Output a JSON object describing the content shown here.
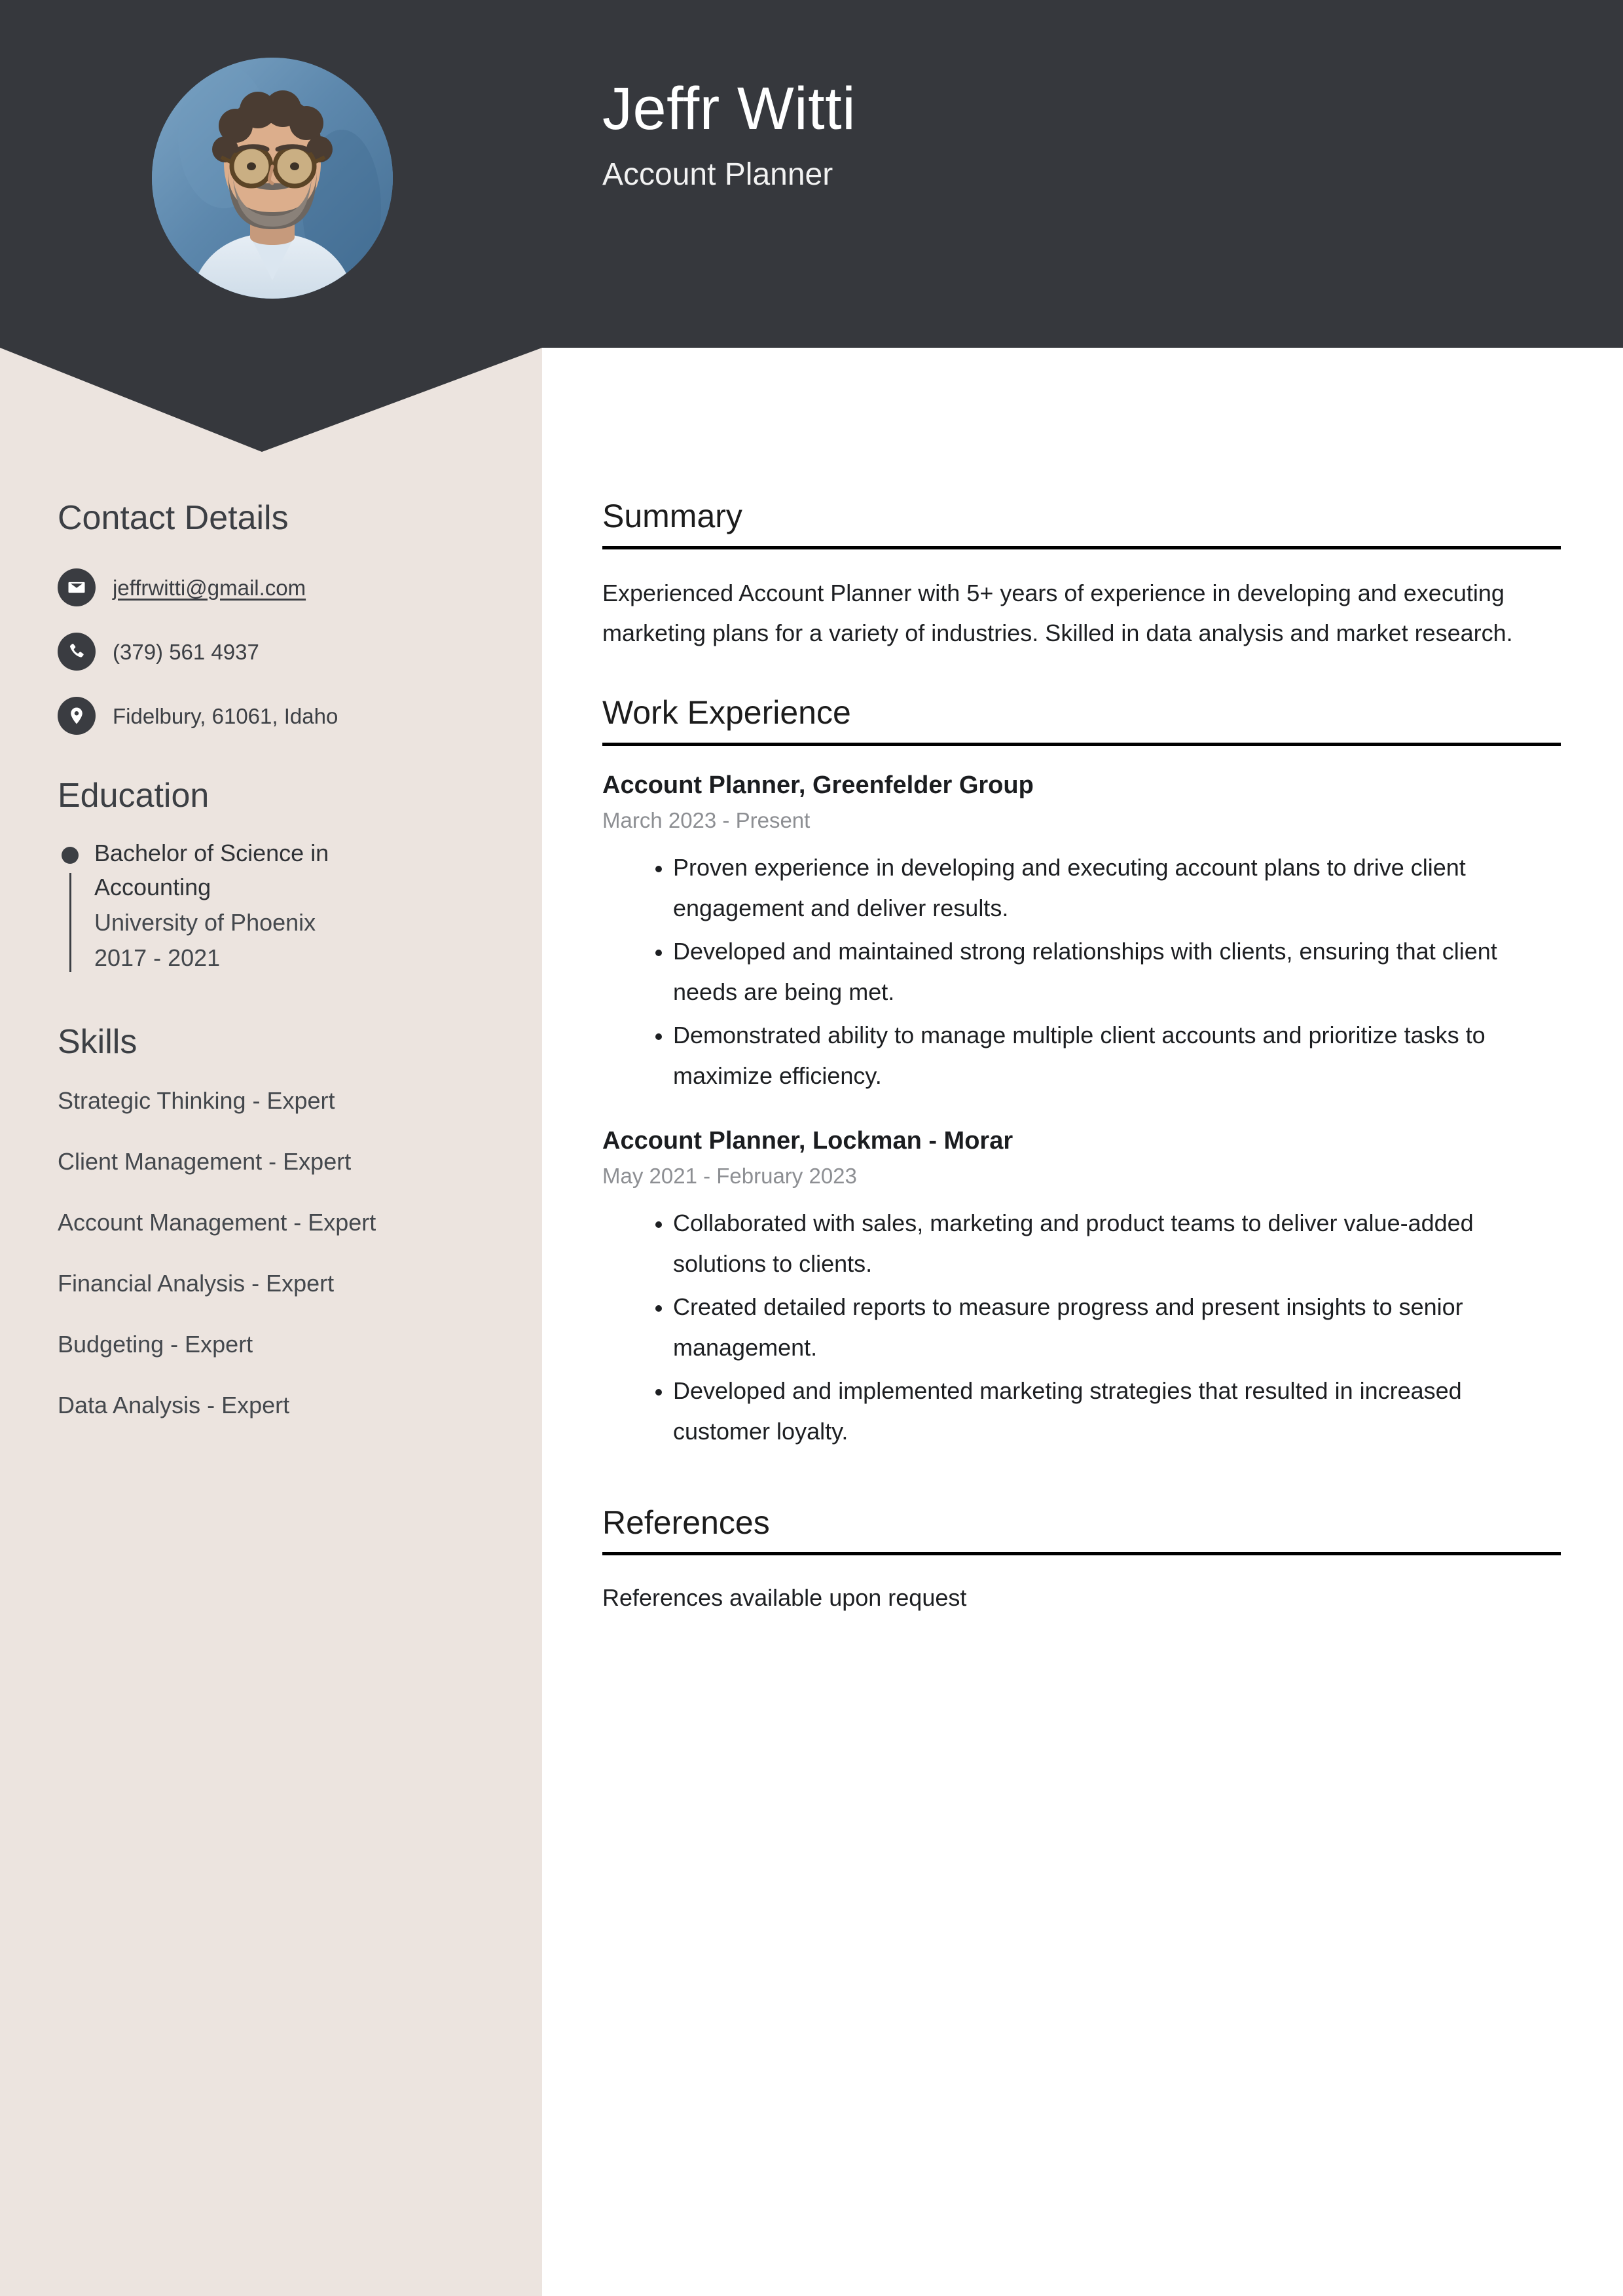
{
  "theme": {
    "header_bg": "#36383d",
    "sidebar_bg": "#ece4df",
    "main_bg": "#ffffff",
    "text_dark": "#1d1f22",
    "muted": "#8d8f93"
  },
  "header": {
    "name": "Jeffr Witti",
    "job_title": "Account Planner",
    "avatar_alt": "profile-photo"
  },
  "sidebar": {
    "contact": {
      "heading": "Contact Details",
      "items": [
        {
          "icon": "envelope-icon",
          "value": "jeffrwitti@gmail.com",
          "is_link": true
        },
        {
          "icon": "phone-icon",
          "value": "(379) 561 4937",
          "is_link": false
        },
        {
          "icon": "location-pin-icon",
          "value": "Fidelbury, 61061, Idaho",
          "is_link": false
        }
      ]
    },
    "education": {
      "heading": "Education",
      "items": [
        {
          "degree": "Bachelor of Science in Accounting",
          "school": "University of Phoenix",
          "dates": "2017 - 2021"
        }
      ]
    },
    "skills": {
      "heading": "Skills",
      "items": [
        "Strategic Thinking - Expert",
        "Client Management - Expert",
        "Account Management - Expert",
        "Financial Analysis - Expert",
        "Budgeting - Expert",
        "Data Analysis - Expert"
      ]
    }
  },
  "main": {
    "summary": {
      "heading": "Summary",
      "text": "Experienced Account Planner with 5+ years of experience in developing and executing marketing plans for a variety of industries. Skilled in data analysis and market research."
    },
    "work_experience": {
      "heading": "Work Experience",
      "jobs": [
        {
          "role": "Account Planner, Greenfelder Group",
          "dates": "March 2023 - Present",
          "bullets": [
            "Proven experience in developing and executing account plans to drive client engagement and deliver results.",
            "Developed and maintained strong relationships with clients, ensuring that client needs are being met.",
            "Demonstrated ability to manage multiple client accounts and prioritize tasks to maximize efficiency."
          ]
        },
        {
          "role": "Account Planner, Lockman - Morar",
          "dates": "May 2021 - February 2023",
          "bullets": [
            "Collaborated with sales, marketing and product teams to deliver value-added solutions to clients.",
            "Created detailed reports to measure progress and present insights to senior management.",
            "Developed and implemented marketing strategies that resulted in increased customer loyalty."
          ]
        }
      ]
    },
    "references": {
      "heading": "References",
      "text": "References available upon request"
    }
  }
}
